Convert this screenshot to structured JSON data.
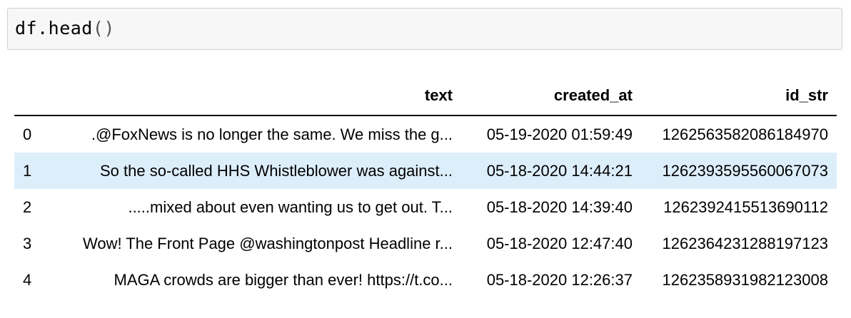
{
  "cell": {
    "code_name": "df.head",
    "code_parens": "()"
  },
  "dataframe": {
    "columns": [
      "",
      "text",
      "created_at",
      "id_str"
    ],
    "rows": [
      {
        "index": "0",
        "text": ".@FoxNews is no longer the same. We miss the g...",
        "created_at": "05-19-2020 01:59:49",
        "id_str": "1262563582086184970"
      },
      {
        "index": "1",
        "text": "So the so-called HHS Whistleblower was against...",
        "created_at": "05-18-2020 14:44:21",
        "id_str": "1262393595560067073"
      },
      {
        "index": "2",
        "text": ".....mixed about even wanting us to get out. T...",
        "created_at": "05-18-2020 14:39:40",
        "id_str": "1262392415513690112"
      },
      {
        "index": "3",
        "text": "Wow! The Front Page @washingtonpost Headline r...",
        "created_at": "05-18-2020 12:47:40",
        "id_str": "1262364231288197123"
      },
      {
        "index": "4",
        "text": "MAGA crowds are bigger than ever! https://t.co...",
        "created_at": "05-18-2020 12:26:37",
        "id_str": "1262358931982123008"
      }
    ]
  },
  "colors": {
    "input_background": "#f7f7f7",
    "input_border": "#cfcfcf",
    "row_highlight": "#ddeefb"
  }
}
